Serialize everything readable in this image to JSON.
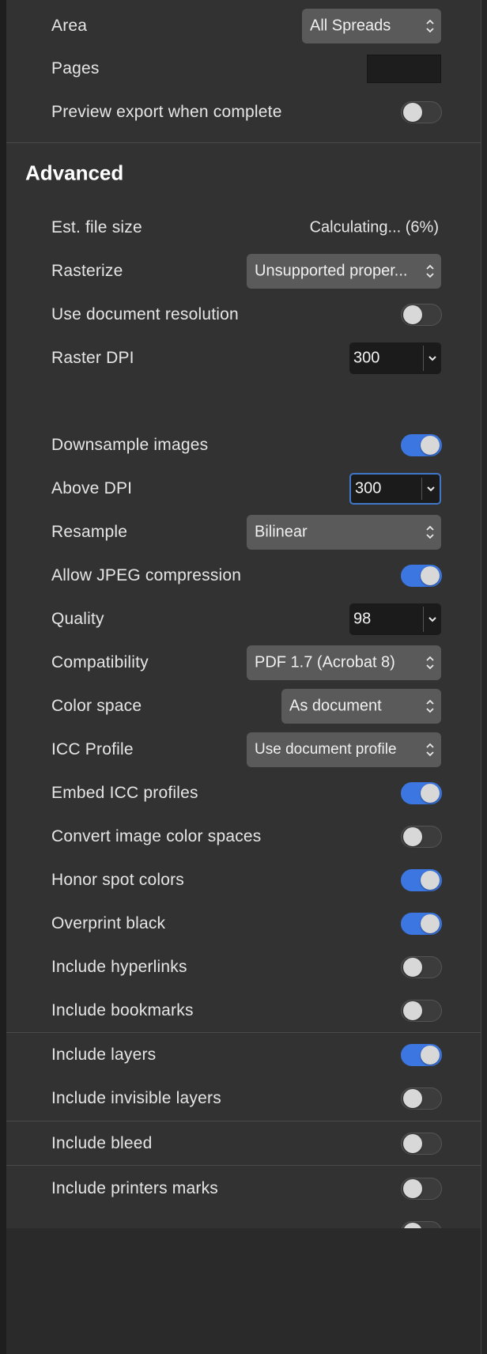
{
  "area": {
    "label": "Area",
    "value": "All Spreads"
  },
  "pages": {
    "label": "Pages",
    "value": ""
  },
  "preview_export": {
    "label": "Preview export when complete",
    "on": false
  },
  "advanced": {
    "title": "Advanced",
    "est_file_size": {
      "label": "Est. file size",
      "value": "Calculating... (6%)"
    },
    "rasterize": {
      "label": "Rasterize",
      "value": "Unsupported proper..."
    },
    "use_doc_resolution": {
      "label": "Use document resolution",
      "on": false
    },
    "raster_dpi": {
      "label": "Raster DPI",
      "value": "300"
    },
    "downsample_images": {
      "label": "Downsample images",
      "on": true
    },
    "above_dpi": {
      "label": "Above DPI",
      "value": "300"
    },
    "resample": {
      "label": "Resample",
      "value": "Bilinear"
    },
    "allow_jpeg": {
      "label": "Allow JPEG compression",
      "on": true
    },
    "quality": {
      "label": "Quality",
      "value": "98"
    },
    "compatibility": {
      "label": "Compatibility",
      "value": "PDF 1.7 (Acrobat 8)"
    },
    "color_space": {
      "label": "Color space",
      "value": "As document"
    },
    "icc_profile": {
      "label": "ICC Profile",
      "value": "Use document profile"
    },
    "embed_icc": {
      "label": "Embed ICC profiles",
      "on": true
    },
    "convert_image_cs": {
      "label": "Convert image color spaces",
      "on": false
    },
    "honor_spot": {
      "label": "Honor spot colors",
      "on": true
    },
    "overprint_black": {
      "label": "Overprint black",
      "on": true
    },
    "include_hyperlinks": {
      "label": "Include hyperlinks",
      "on": false
    },
    "include_bookmarks": {
      "label": "Include bookmarks",
      "on": false
    },
    "include_layers": {
      "label": "Include layers",
      "on": true
    },
    "include_invisible_layers": {
      "label": "Include invisible layers",
      "on": false
    },
    "include_bleed": {
      "label": "Include bleed",
      "on": false
    },
    "include_printers_marks": {
      "label": "Include printers marks",
      "on": false
    }
  },
  "colors": {
    "panel_bg": "#323232",
    "accent": "#3c76e0",
    "control_bg": "#5a5a5a",
    "field_bg": "#1b1b1b"
  }
}
